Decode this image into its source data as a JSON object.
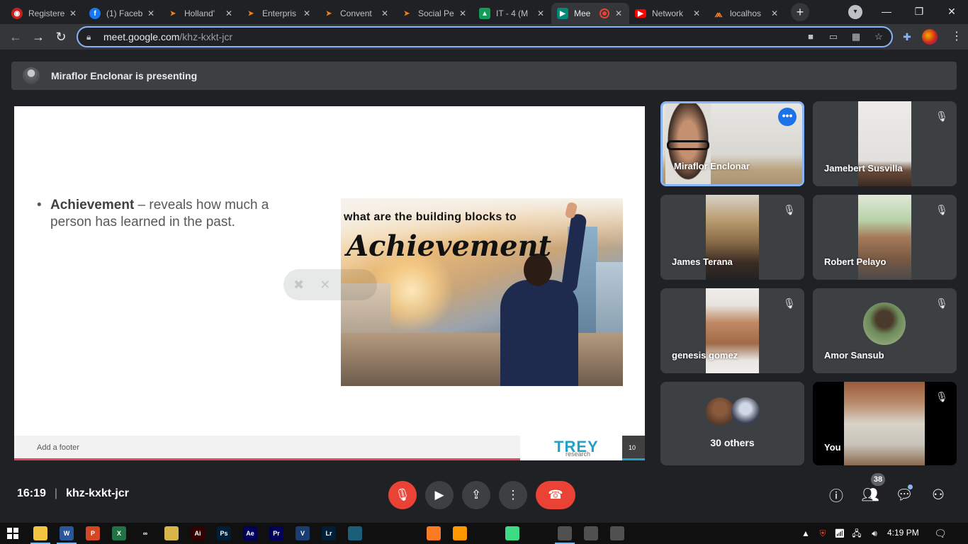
{
  "browser": {
    "tabs": [
      {
        "label": "Registere",
        "icon": "registration-icon",
        "color": "#c5221f"
      },
      {
        "label": "(1) Faceb",
        "icon": "facebook-icon",
        "color": "#1877f2"
      },
      {
        "label": "Holland'",
        "icon": "moodle-icon",
        "color": "#f98012"
      },
      {
        "label": "Enterpris",
        "icon": "moodle-icon",
        "color": "#f98012"
      },
      {
        "label": "Convent",
        "icon": "moodle-icon",
        "color": "#f98012"
      },
      {
        "label": "Social Pe",
        "icon": "moodle-icon",
        "color": "#f98012"
      },
      {
        "label": "IT - 4 (M",
        "icon": "classroom-icon",
        "color": "#0f9d58"
      },
      {
        "label": "Mee",
        "icon": "meet-icon",
        "color": "#00897b"
      },
      {
        "label": "Network",
        "icon": "youtube-icon",
        "color": "#ff0000"
      },
      {
        "label": "localhos",
        "icon": "xampp-icon",
        "color": "#fb7a24"
      }
    ],
    "url_host": "meet.google.com",
    "url_path": "/khz-kxkt-jcr"
  },
  "meet": {
    "presenting_text": "Miraflor Enclonar is presenting",
    "slide": {
      "term": "Achievement",
      "definition": " – reveals how much a person has learned in the past.",
      "image_line1": "what are the building blocks to",
      "image_line2": "Achievement",
      "footer_text": "Add a footer",
      "logo_main": "TREY",
      "logo_sub": "research",
      "page_number": "10"
    },
    "participants": [
      {
        "name": "Miraflor Enclonar",
        "muted": false,
        "active": true
      },
      {
        "name": "Jamebert Susvilla",
        "muted": true
      },
      {
        "name": "James Terana",
        "muted": true
      },
      {
        "name": "Robert Pelayo",
        "muted": true
      },
      {
        "name": "genesis gomez",
        "muted": true
      },
      {
        "name": "Amor Sansub",
        "muted": true
      },
      {
        "name": "You",
        "muted": true
      }
    ],
    "others_label": "30 others",
    "time": "16:19",
    "meeting_code": "khz-kxkt-jcr",
    "people_count": "38"
  },
  "taskbar": {
    "apps": [
      {
        "label": "",
        "icon": "file-explorer-icon",
        "color": "#f4c542"
      },
      {
        "label": "W",
        "icon": "word-icon",
        "color": "#2b579a"
      },
      {
        "label": "P",
        "icon": "powerpoint-icon",
        "color": "#d24726"
      },
      {
        "label": "X",
        "icon": "excel-icon",
        "color": "#217346"
      },
      {
        "label": "∞",
        "icon": "infinity-icon",
        "color": "#101010"
      },
      {
        "label": "",
        "icon": "paint-icon",
        "color": "#d8b54a"
      },
      {
        "label": "Ai",
        "icon": "illustrator-icon",
        "color": "#330000"
      },
      {
        "label": "Ps",
        "icon": "photoshop-icon",
        "color": "#001e36"
      },
      {
        "label": "Ae",
        "icon": "after-effects-icon",
        "color": "#00005b"
      },
      {
        "label": "Pr",
        "icon": "premiere-icon",
        "color": "#00005b"
      },
      {
        "label": "V",
        "icon": "vegas-icon",
        "color": "#1c3d73"
      },
      {
        "label": "Lr",
        "icon": "lightroom-icon",
        "color": "#001e36"
      },
      {
        "label": "",
        "icon": "packet-tracer-icon",
        "color": "#1b5e7a"
      },
      {
        "label": "",
        "icon": "vlc-icon",
        "color": "#101010"
      },
      {
        "label": "",
        "icon": "chrome-icon",
        "color": "#101010"
      },
      {
        "label": "",
        "icon": "xampp-icon",
        "color": "#fb7a24"
      },
      {
        "label": "",
        "icon": "sublime-icon",
        "color": "#ff9800"
      },
      {
        "label": "",
        "icon": "vscode-icon",
        "color": "#101010"
      },
      {
        "label": "",
        "icon": "android-studio-icon",
        "color": "#3ddc84"
      },
      {
        "label": "",
        "icon": "record-icon",
        "color": "#101010"
      },
      {
        "label": "",
        "icon": "chrome-running-icon",
        "color": "#505050"
      },
      {
        "label": "",
        "icon": "notepad-icon",
        "color": "#505050"
      },
      {
        "label": "",
        "icon": "photos-icon",
        "color": "#505050"
      }
    ],
    "clock": "4:19 PM"
  }
}
